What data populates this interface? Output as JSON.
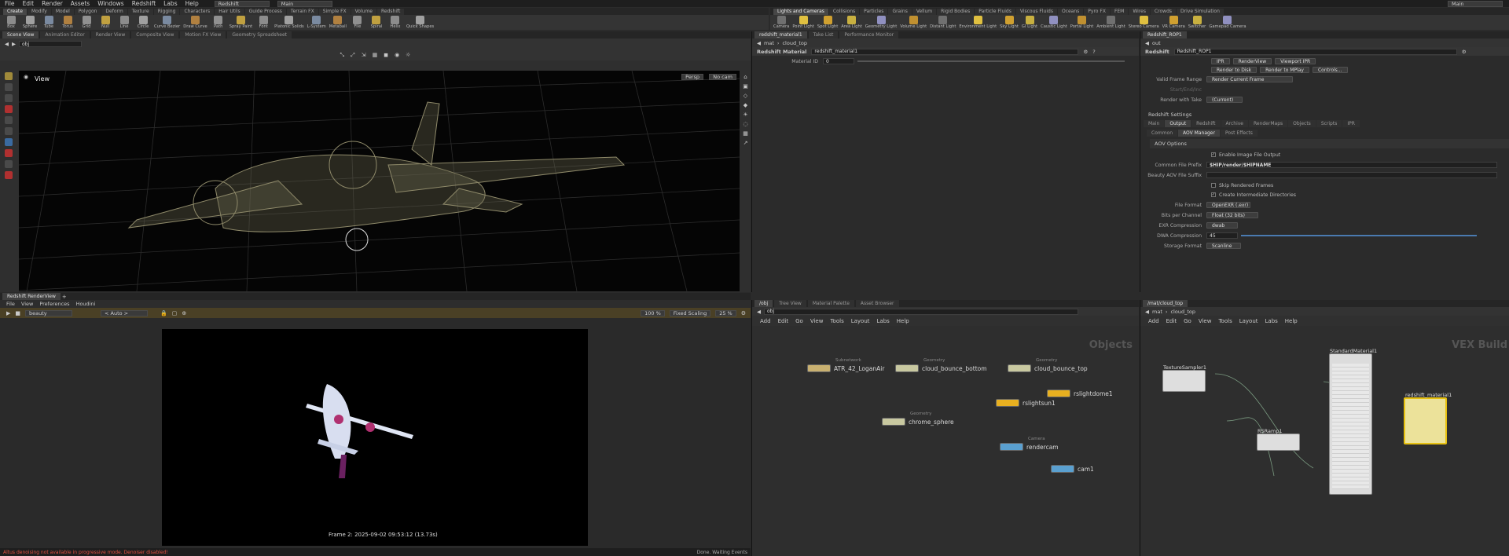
{
  "menubar": {
    "items": [
      "File",
      "Edit",
      "Render",
      "Assets",
      "Windows",
      "Redshift",
      "Labs",
      "Help"
    ],
    "desktop": "Redshift",
    "context": "Main",
    "right_context": "Main"
  },
  "shelf_left": {
    "tabs": [
      "Create",
      "Modify",
      "Model",
      "Polygon",
      "Deform",
      "Texture",
      "Rigging",
      "Characters",
      "Hair Utils",
      "Guide Process",
      "Terrain FX",
      "Simple FX",
      "Volume",
      "Redshift"
    ],
    "tools": [
      "Box",
      "Sphere",
      "Tube",
      "Torus",
      "Grid",
      "Null",
      "Line",
      "Circle",
      "Curve Bezier",
      "Draw Curve",
      "Path",
      "Spray Paint",
      "Font",
      "Platonic Solids",
      "L-System",
      "Metaball",
      "File",
      "Spiral",
      "Helix",
      "Quick Shapes"
    ]
  },
  "shelf_right": {
    "tabs": [
      "Lights and Cameras",
      "Collisions",
      "Particles",
      "Grains",
      "Vellum",
      "Rigid Bodies",
      "Particle Fluids",
      "Viscous Fluids",
      "Oceans",
      "Pyro FX",
      "FEM",
      "Wires",
      "Crowds",
      "Drive Simulation"
    ],
    "tools": [
      "Camera",
      "Point Light",
      "Spot Light",
      "Area Light",
      "Geometry Light",
      "Volume Light",
      "Distant Light",
      "Environment Light",
      "Sky Light",
      "GI Light",
      "Caustic Light",
      "Portal Light",
      "Ambient Light",
      "Stereo Camera",
      "VR Camera",
      "Switcher",
      "Gamepad Camera"
    ]
  },
  "scene_view": {
    "tabs": [
      "Scene View",
      "Animation Editor",
      "Render View",
      "Composite View",
      "Motion FX View",
      "Geometry Spreadsheet"
    ],
    "path": "obj",
    "label": "View",
    "persp": "Persp",
    "cam": "No cam"
  },
  "render_view": {
    "tab": "Redshift RenderView",
    "menu": [
      "File",
      "View",
      "Preferences",
      "Houdini"
    ],
    "aov": "beauty",
    "auto": "< Auto >",
    "zoom": "100 %",
    "scaling": "Fixed Scaling",
    "scale_pct": "25 %",
    "frame_info": "Frame 2: 2025-09-02 09:53:12 (13.73s)",
    "status_left": "Altus denoising not available in progressive mode. Denoiser disabled!",
    "status_right": "Done. Waiting Events"
  },
  "material_panel": {
    "tabs": [
      "redshift_material1",
      "Take List",
      "Performance Monitor"
    ],
    "path_a": "mat",
    "path_b": "cloud_top",
    "type": "Redshift Material",
    "name": "redshift_material1",
    "material_id_label": "Material ID",
    "material_id_value": "0"
  },
  "rop_panel": {
    "tab": "Redshift_ROP1",
    "path": "out",
    "type": "Redshift",
    "name": "Redshift_ROP1",
    "buttons_row1": [
      "IPR",
      "RenderView",
      "Viewport IPR"
    ],
    "buttons_row2": [
      "Render to Disk",
      "Render to MPlay",
      "Controls..."
    ],
    "frame_range_label": "Valid Frame Range",
    "frame_range_value": "Render Current Frame",
    "start_end_label": "Start/End/Inc",
    "take_label": "Render with Take",
    "take_value": "(Current)",
    "settings_title": "Redshift Settings",
    "main_tabs": [
      "Main",
      "Output",
      "Redshift",
      "Archive",
      "RenderMaps",
      "Objects",
      "Scripts",
      "IPR"
    ],
    "sub_tabs": [
      "Common",
      "AOV Manager",
      "Post Effects"
    ],
    "aov_options": "AOV Options",
    "enable_output": "Enable Image File Output",
    "prefix_label": "Common File Prefix",
    "prefix_value": "$HIP/render/$HIPNAME",
    "suffix_label": "Beauty AOV File Suffix",
    "skip_label": "Skip Rendered Frames",
    "create_dirs": "Create Intermediate Directories",
    "format_label": "File Format",
    "format_value": "OpenEXR (.exr)",
    "bits_label": "Bits per Channel",
    "bits_value": "Float (32 bits)",
    "exr_comp_label": "EXR Compression",
    "exr_comp_value": "dwab",
    "dwa_label": "DWA Compression",
    "dwa_value": "45",
    "storage_label": "Storage Format",
    "storage_value": "Scanline"
  },
  "obj_network": {
    "tabs": [
      "/obj",
      "Tree View",
      "Material Palette",
      "Asset Browser"
    ],
    "path": "obj",
    "menu": [
      "Add",
      "Edit",
      "Go",
      "View",
      "Tools",
      "Layout",
      "Labs",
      "Help"
    ],
    "title": "Objects",
    "nodes": [
      {
        "name": "ATR_42_LoganAir",
        "cap": "Subnetwork"
      },
      {
        "name": "cloud_bounce_bottom",
        "cap": "Geometry"
      },
      {
        "name": "cloud_bounce_top",
        "cap": "Geometry"
      },
      {
        "name": "rslightdome1",
        "cap": ""
      },
      {
        "name": "rslightsun1",
        "cap": ""
      },
      {
        "name": "chrome_sphere",
        "cap": "Geometry"
      },
      {
        "name": "rendercam",
        "cap": "Camera"
      },
      {
        "name": "cam1",
        "cap": ""
      }
    ]
  },
  "mat_network": {
    "tab": "/mat/cloud_top",
    "path_a": "mat",
    "path_b": "cloud_top",
    "menu": [
      "Add",
      "Edit",
      "Go",
      "View",
      "Tools",
      "Layout",
      "Labs",
      "Help"
    ],
    "title": "VEX Build",
    "nodes": [
      "TextureSampler1",
      "StandardMaterial1",
      "RSRamp1",
      "redshift_material1"
    ]
  }
}
